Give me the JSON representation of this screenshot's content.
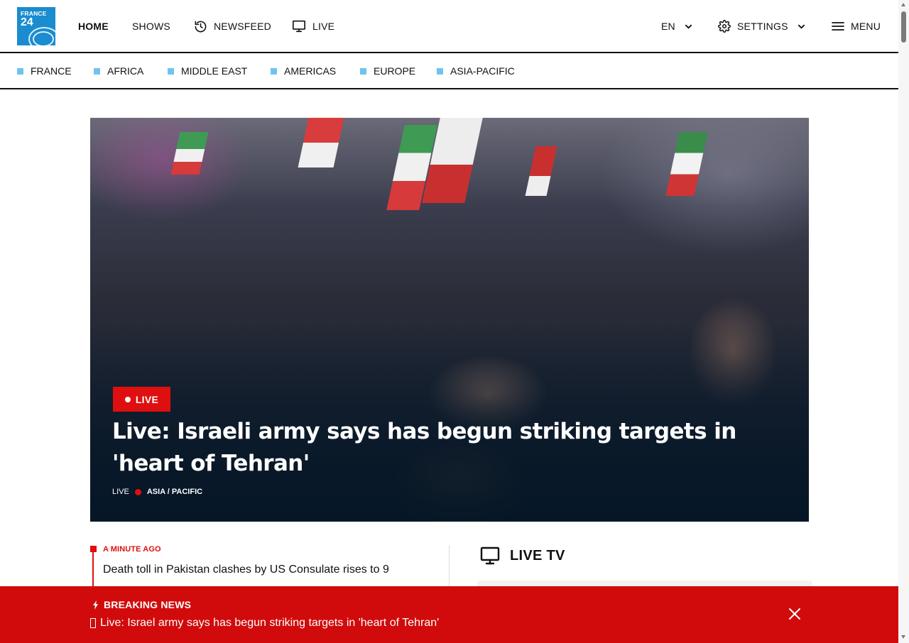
{
  "header": {
    "logo": {
      "line1": "FRANCE",
      "line2": "24"
    },
    "nav": [
      {
        "label": "HOME",
        "icon": null
      },
      {
        "label": "SHOWS",
        "icon": null
      },
      {
        "label": "NEWSFEED",
        "icon": "history-icon"
      },
      {
        "label": "LIVE",
        "icon": "tv-icon"
      }
    ],
    "language": "EN",
    "settings_label": "SETTINGS",
    "menu_label": "MENU"
  },
  "regions": [
    "FRANCE",
    "AFRICA",
    "MIDDLE EAST",
    "AMERICAS",
    "EUROPE",
    "ASIA-PACIFIC"
  ],
  "hero": {
    "badge": "LIVE",
    "title": "Live: Israeli army says has begun striking targets in 'heart of Tehran'",
    "meta_label": "LIVE",
    "category": "ASIA / PACIFIC"
  },
  "feed": {
    "time": "A MINUTE AGO",
    "headline": "Death toll in Pakistan clashes by US Consulate rises to 9"
  },
  "live_tv": {
    "label": "LIVE TV"
  },
  "breaking": {
    "label": "BREAKING NEWS",
    "text": "Live: Israel army says has begun striking targets in 'heart of Tehran'"
  },
  "colors": {
    "accent_red": "#e00f0f",
    "breaking_red": "#d10b0b",
    "region_square": "#6ec4ee",
    "logo_blue": "#1a8ccf"
  }
}
